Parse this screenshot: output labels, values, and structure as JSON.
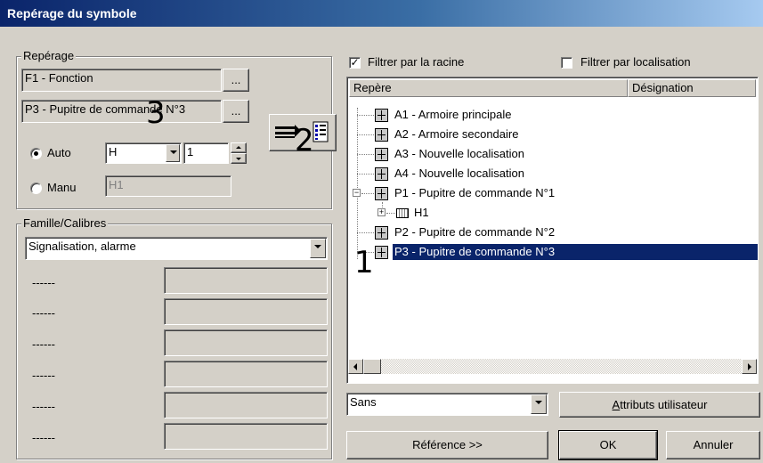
{
  "window": {
    "title": "Repérage du symbole"
  },
  "reperage": {
    "group_label": "Repérage",
    "fonction_value": "F1 - Fonction",
    "localisation_value": "P3 - Pupitre de commande N°3",
    "browse_label": "...",
    "auto_label": "Auto",
    "auto_selected": true,
    "auto_prefix": "H",
    "auto_number": "1",
    "manu_label": "Manu",
    "manu_value": "H1",
    "transfer_icon": "transfer-icon"
  },
  "famille": {
    "group_label": "Famille/Calibres",
    "selected": "Signalisation, alarme",
    "rows": [
      {
        "label": "------",
        "value": ""
      },
      {
        "label": "------",
        "value": ""
      },
      {
        "label": "------",
        "value": ""
      },
      {
        "label": "------",
        "value": ""
      },
      {
        "label": "------",
        "value": ""
      },
      {
        "label": "------",
        "value": ""
      }
    ]
  },
  "filters": {
    "racine_label": "Filtrer par la racine",
    "racine_checked": true,
    "localisation_label": "Filtrer par localisation",
    "localisation_checked": false
  },
  "tree": {
    "col_repere": "Repère",
    "col_designation": "Désignation",
    "items": [
      {
        "label": "A1 - Armoire principale",
        "level": 0,
        "icon": "cabinet-icon",
        "expander": ""
      },
      {
        "label": "A2 - Armoire secondaire",
        "level": 0,
        "icon": "cabinet-icon",
        "expander": ""
      },
      {
        "label": "A3 - Nouvelle localisation",
        "level": 0,
        "icon": "cabinet-icon",
        "expander": ""
      },
      {
        "label": "A4 - Nouvelle localisation",
        "level": 0,
        "icon": "cabinet-icon",
        "expander": ""
      },
      {
        "label": "P1 - Pupitre de commande N°1",
        "level": 0,
        "icon": "cabinet-icon",
        "expander": "−"
      },
      {
        "label": "H1",
        "level": 1,
        "icon": "component-icon",
        "expander": "+"
      },
      {
        "label": "P2 - Pupitre de commande N°2",
        "level": 0,
        "icon": "cabinet-icon",
        "expander": ""
      },
      {
        "label": "P3 - Pupitre de commande N°3",
        "level": 0,
        "icon": "cabinet-icon",
        "expander": "",
        "selected": true
      }
    ]
  },
  "bottom": {
    "sans_value": "Sans",
    "attributs_prefix": "A",
    "attributs_rest": "ttributs utilisateur",
    "reference_label": "Référence >>",
    "ok_label": "OK",
    "annuler_label": "Annuler"
  },
  "annotations": {
    "one": "1",
    "two": "2",
    "three": "3"
  }
}
